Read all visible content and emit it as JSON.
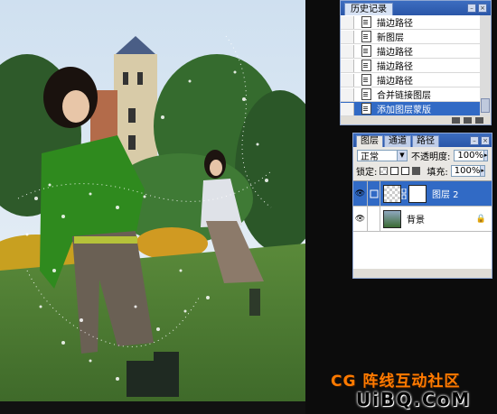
{
  "history_panel": {
    "tab_label": "历史记录",
    "items": [
      {
        "label": "描边路径"
      },
      {
        "label": "新图层"
      },
      {
        "label": "描边路径"
      },
      {
        "label": "描边路径"
      },
      {
        "label": "描边路径"
      },
      {
        "label": "合并链接图层"
      },
      {
        "label": "添加图层蒙版",
        "active": true
      }
    ]
  },
  "layers_panel": {
    "tabs": [
      "图层",
      "通道",
      "路径"
    ],
    "blend_mode": "正常",
    "opacity_label": "不透明度:",
    "opacity_value": "100%",
    "lock_label": "锁定:",
    "fill_label": "填充:",
    "fill_value": "100%",
    "layers": [
      {
        "name": "图层 2",
        "active": true
      },
      {
        "name": "背景",
        "active": false
      }
    ]
  },
  "watermark": {
    "line1": "CG 阵线互动社区",
    "line2": "UiBQ.CoM"
  },
  "colors": {
    "panel_title": "#2a56a8",
    "selection": "#316ac5",
    "watermark_orange": "#ff7a00"
  }
}
